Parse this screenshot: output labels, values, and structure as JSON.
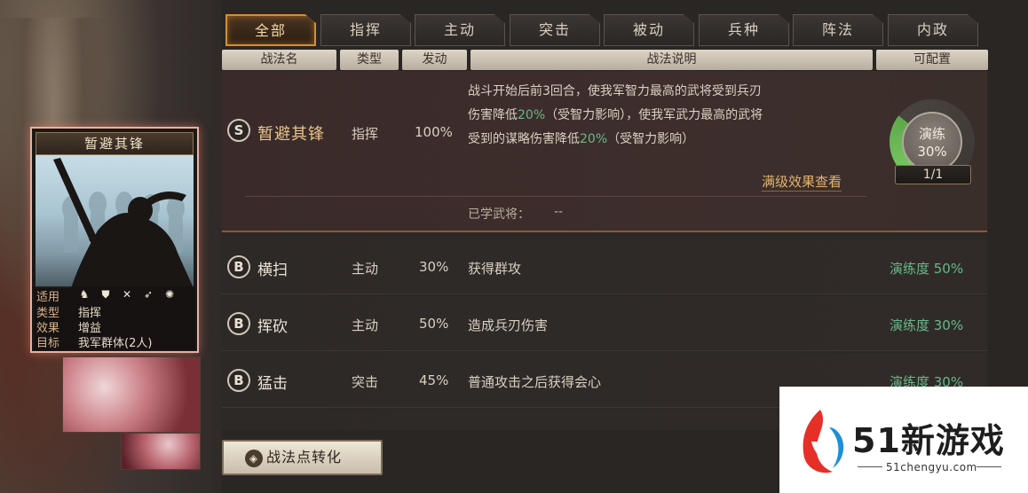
{
  "tabs": [
    {
      "label": "全部",
      "active": true
    },
    {
      "label": "指挥"
    },
    {
      "label": "主动"
    },
    {
      "label": "突击"
    },
    {
      "label": "被动"
    },
    {
      "label": "兵种"
    },
    {
      "label": "阵法"
    },
    {
      "label": "内政"
    }
  ],
  "columns": {
    "name": "战法名",
    "type": "类型",
    "rate": "发动",
    "desc": "战法说明",
    "config": "可配置"
  },
  "featured": {
    "grade": "S",
    "name": "暂避其锋",
    "type": "指挥",
    "rate": "100%",
    "desc_line1": "战斗开始后前3回合，使我军智力最高的武将受到兵刃",
    "desc_line2_a": "伤害降低",
    "desc_line2_b": "20%",
    "desc_line2_c": "（受智力影响），使我军武力最高的武将",
    "desc_line3_a": "受到的谋略伤害降低",
    "desc_line3_b": "20%",
    "desc_line3_c": "（受智力影响）",
    "full_effect_link": "满级效果查看",
    "learned_label": "已学武将：",
    "learned_value": "--",
    "practice_label": "演练",
    "practice_value": "30%",
    "practice_fraction": 0.3,
    "count": "1/1"
  },
  "skills": [
    {
      "grade": "B",
      "name": "横扫",
      "type": "主动",
      "rate": "30%",
      "desc": "获得群攻",
      "practice": "演练度 50%"
    },
    {
      "grade": "B",
      "name": "挥砍",
      "type": "主动",
      "rate": "50%",
      "desc": "造成兵刃伤害",
      "practice": "演练度 30%"
    },
    {
      "grade": "B",
      "name": "猛击",
      "type": "突击",
      "rate": "45%",
      "desc": "普通攻击之后获得会心",
      "practice": "演练度 30%"
    }
  ],
  "card": {
    "title": "暂避其锋",
    "suit_label": "适用",
    "type_label": "类型",
    "type_value": "指挥",
    "effect_label": "效果",
    "effect_value": "增益",
    "target_label": "目标",
    "target_value": "我军群体(2人)",
    "troop_icons": [
      "horse-icon",
      "shield-icon",
      "crossed-spears-icon",
      "bow-icon",
      "wheel-icon"
    ]
  },
  "convert_button": "战法点转化",
  "watermark": {
    "text": "51新游戏",
    "url": "51chengyu.com"
  },
  "colors": {
    "accent_orange": "#d98c2e",
    "highlight_green": "#69b889",
    "card_border": "#e8b1a2"
  }
}
